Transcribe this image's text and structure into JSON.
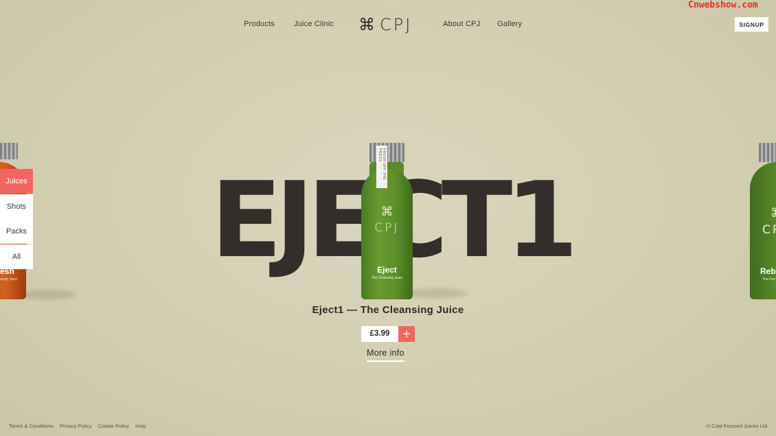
{
  "watermark": "Cnwebshow.com",
  "nav": {
    "products": "Products",
    "juice_clinic": "Juice Clinic",
    "logo_glyph": "⌘",
    "logo_text": "CPJ",
    "about": "About CPJ",
    "gallery": "Gallery",
    "signup": "SIGNUP"
  },
  "hero": {
    "big_word": "EJECT1",
    "bottle_strip": "FRESH OFF THE PRESS",
    "bottle_glyph": "⌘",
    "bottle_brand": "CPJ",
    "bottle_name": "Eject",
    "bottle_sub": "The Cleansing Juice"
  },
  "left_bottle": {
    "name": "esh",
    "sub": "acing Juice"
  },
  "right_bottle": {
    "glyph": "⌘",
    "brand": "CP",
    "name": "Reb",
    "sub": "The Fort"
  },
  "filters": [
    {
      "label": "Juices",
      "active": true
    },
    {
      "label": "Shots",
      "active": false
    },
    {
      "label": "Packs",
      "active": false
    },
    {
      "label": "All",
      "active": false
    }
  ],
  "product": {
    "title": "Eject1 — The Cleansing Juice",
    "price": "£3.99",
    "add_symbol": "+",
    "more_info": "More info"
  },
  "footer": {
    "terms": "Terms & Conditions",
    "privacy": "Privacy Policy",
    "cookie": "Cookie Policy",
    "help": "Help",
    "copyright": "© Cold Pressed Juices Ltd."
  },
  "colors": {
    "accent": "#f0675f",
    "background": "#d4d1b6",
    "text": "#2e2a27"
  }
}
